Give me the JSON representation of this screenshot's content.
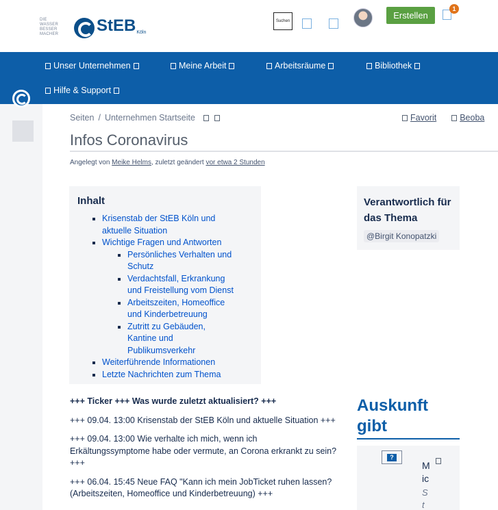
{
  "header": {
    "brand_small": "DIE WASSER BESSER MACHER",
    "brand_name": "StEB",
    "brand_sub": "Köln",
    "search_label": "Suchen",
    "create_label": "Erstellen",
    "notification_count": "1"
  },
  "nav": {
    "items": [
      {
        "label": "Unser Unternehmen"
      },
      {
        "label": "Meine Arbeit"
      },
      {
        "label": "Arbeitsräume"
      },
      {
        "label": "Bibliothek"
      },
      {
        "label": "Hilfe & Support"
      }
    ]
  },
  "breadcrumb": {
    "root": "Seiten",
    "separator": "/",
    "parent": "Unternehmen Startseite"
  },
  "actions": {
    "favorite": "Favorit",
    "watch": "Beoba"
  },
  "page": {
    "title": "Infos Coronavirus",
    "byline_prefix": "Angelegt von",
    "author": "Meike Helms",
    "byline_mid": ", zuletzt geändert",
    "modified": "vor etwa 2 Stunden"
  },
  "toc": {
    "heading": "Inhalt",
    "items": [
      {
        "label": "Krisenstab der StEB Köln und aktuelle Situation"
      },
      {
        "label": "Wichtige Fragen und Antworten",
        "children": [
          "Persönliches Verhalten und Schutz",
          "Verdachtsfall, Erkrankung und Freistellung vom Dienst",
          "Arbeitszeiten, Homeoffice und Kinderbetreuung",
          "Zutritt zu Gebäuden, Kantine und Publikumsverkehr"
        ]
      },
      {
        "label": "Weiterführende Informationen"
      },
      {
        "label": "Letzte Nachrichten zum Thema"
      }
    ]
  },
  "responsible": {
    "heading": "Verantwortlich für das Thema",
    "mention": "@Birgit Konopatzki"
  },
  "ticker": {
    "heading": "+++ Ticker +++ Was wurde zuletzt aktualisiert? +++",
    "entries": [
      "+++ 09.04. 13:00 Krisenstab der StEB Köln und aktuelle Situation +++",
      "+++ 09.04. 13:00 Wie verhalte ich mich, wenn ich Erkältungssymptome habe oder vermute, an Corona erkrankt zu sein? +++",
      "+++ 06.04. 15:45 Neue FAQ \"Kann ich mein JobTicket ruhen lassen? (Arbeitszeiten, Homeoffice und Kinderbetreuung) +++"
    ]
  },
  "auskunft": {
    "heading": "Auskunft gibt",
    "card_img_text": "?",
    "card_name": "M ic",
    "card_role": "S t"
  },
  "icons": {
    "logo": "steb-logo-icon",
    "avatar": "user-avatar",
    "placeholder": "square-placeholder-icon"
  },
  "colors": {
    "brand_blue": "#0d5ea8",
    "create_green": "#5aa042",
    "badge_orange": "#e0731a",
    "link_blue": "#0052cc"
  }
}
